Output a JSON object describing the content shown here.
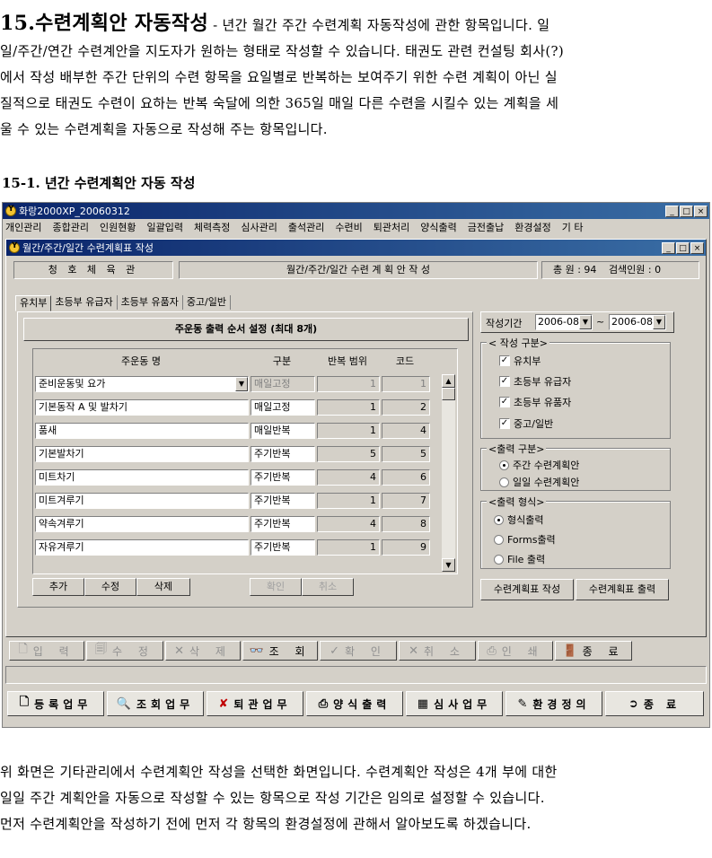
{
  "doc": {
    "section_title": "15.수련계획안 자동작성",
    "intro_line1_rest": " - 년간 월간 주간 수련계획 자동작성에 관한 항목입니다. 일",
    "intro_lines": [
      "일/주간/연간 수련계안을 지도자가 원하는 형태로 작성할 수 있습니다. 태권도 관련 컨설팅 회사(?)",
      "에서 작성 배부한 주간 단위의 수련 항목을 요일별로 반복하는 보여주기 위한 수련 계획이 아닌 실",
      "질적으로 태권도 수련이 요하는 반복 숙달에 의한 365일 매일 다른 수련을 시킬수 있는 계획을 세",
      "울 수 있는 수련계획을 자동으로 작성해 주는 항목입니다."
    ],
    "subsection": "15-1. 년간 수련계획안 자동 작성",
    "outro_lines": [
      "위 화면은 기타관리에서 수련계획안 작성을 선택한 화면입니다. 수련계획안 작성은 4개 부에 대한",
      "일일 주간 계획안을 자동으로 작성할 수 있는 항목으로 작성 기간은 임의로 설정할 수 있습니다.",
      "먼저 수련계획안을 작성하기 전에 먼저 각 항목의 환경설정에 관해서 알아보도록 하겠습니다."
    ]
  },
  "app": {
    "title": "화랑2000XP_20060312",
    "menu": [
      "개인관리",
      "종합관리",
      "인원현황",
      "일괄입력",
      "체력측정",
      "심사관리",
      "출석관리",
      "수련비",
      "퇴관처리",
      "양식출력",
      "금전출납",
      "환경설정",
      "기 타"
    ],
    "window_buttons": [
      "_",
      "□",
      "×"
    ]
  },
  "child": {
    "title": "월간/주간/일간 수련계획표 작성",
    "gym_name": "청 호 체 육 관",
    "form_title": "월간/주간/일간 수련 계 획 안 작 성",
    "total": "총 원 : 94",
    "search_count": "검색인원 : 0",
    "tabs": [
      "유치부",
      "초등부 유급자",
      "초등부 유품자",
      "중고/일반"
    ],
    "panel_title": "주운동 출력 순서 설정 (최대 8개)",
    "grid_headers": [
      "주운동 명",
      "구분",
      "반복 범위",
      "코드"
    ],
    "rows": [
      {
        "name": "준비운동및 요가",
        "type": "매일고정",
        "range": "1",
        "code": "1"
      },
      {
        "name": "기본동작 A 및 발차기",
        "type": "매일고정",
        "range": "1",
        "code": "2"
      },
      {
        "name": "품새",
        "type": "매일반복",
        "range": "1",
        "code": "4"
      },
      {
        "name": "기본발차기",
        "type": "주기반복",
        "range": "5",
        "code": "5"
      },
      {
        "name": "미트차기",
        "type": "주기반복",
        "range": "4",
        "code": "6"
      },
      {
        "name": "미트겨루기",
        "type": "주기반복",
        "range": "1",
        "code": "7"
      },
      {
        "name": "약속겨루기",
        "type": "주기반복",
        "range": "4",
        "code": "8"
      },
      {
        "name": "자유겨루기",
        "type": "주기반복",
        "range": "1",
        "code": "9"
      }
    ],
    "btn_add": "추가",
    "btn_edit": "수정",
    "btn_delete": "삭제",
    "btn_confirm": "확인",
    "btn_cancel": "취소",
    "period_label": "작성기간",
    "period_from": "2006-08",
    "period_sep": "~",
    "period_to": "2006-08",
    "group_type": {
      "legend": "< 작성 구분>",
      "items": [
        "유치부",
        "초등부 유급자",
        "초등부 유품자",
        "중고/일반"
      ],
      "checked": [
        true,
        true,
        true,
        true
      ]
    },
    "group_output": {
      "legend": "<출력 구분>",
      "items": [
        "주간 수련계획안",
        "일일 수련계획안"
      ],
      "selected": 0
    },
    "group_format": {
      "legend": "<출력 형식>",
      "items": [
        "형식출력",
        "Forms출력",
        "File 출력"
      ],
      "selected": 0
    },
    "btn_make": "수련계획표 작성",
    "btn_print": "수련계획표 출력"
  },
  "toolbar1": [
    "입 력",
    "수 정",
    "삭 제",
    "조 회",
    "확 인",
    "취 소",
    "인 쇄",
    "종 료"
  ],
  "toolbar2": [
    "등록업무",
    "조회업무",
    "퇴관업무",
    "양식출력",
    "심사업무",
    "환경정의",
    "종 료"
  ]
}
